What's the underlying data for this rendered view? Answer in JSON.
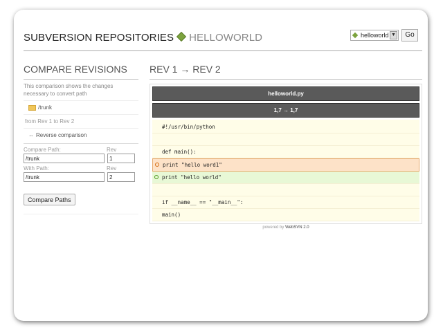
{
  "header": {
    "title": "SUBVERSION REPOSITORIES",
    "repo": "HELLOWORLD",
    "select_value": "helloworld",
    "go_label": "Go"
  },
  "left": {
    "heading": "COMPARE REVISIONS",
    "description": "This comparison shows the changes necessary to convert path",
    "path_link": "/trunk",
    "rev_text": "from Rev 1 to Rev 2",
    "reverse_label": "Reverse comparison",
    "compare_path_label": "Compare Path:",
    "rev_label": "Rev",
    "compare_path": "/trunk",
    "compare_rev": "1",
    "with_path_label": "With Path:",
    "with_rev_label": "Rev",
    "with_path": "/trunk",
    "with_rev": "2",
    "compare_button": "Compare Paths"
  },
  "right": {
    "heading": "REV 1 → REV 2",
    "filename": "helloworld.py",
    "line_range": "1,7 → 1,7",
    "lines": [
      {
        "text": "#!/usr/bin/python",
        "type": "context"
      },
      {
        "text": "",
        "type": "context"
      },
      {
        "text": "def main():",
        "type": "context"
      },
      {
        "text": "print \"hello word1\"",
        "type": "del"
      },
      {
        "text": "print \"hello world\"",
        "type": "add"
      },
      {
        "text": "",
        "type": "context"
      },
      {
        "text": "if __name__ == \"__main__\":",
        "type": "context"
      },
      {
        "text": "main()",
        "type": "context"
      }
    ],
    "powered_by": "powered by",
    "websvn": "WebSVN 2.0"
  },
  "colors": {
    "accent_green": "#7ca33e",
    "diff_removed": "#fde2c8",
    "diff_added": "#e8f8d6",
    "code_bg": "#fffde8",
    "bar_bg": "#5a5a5a"
  }
}
